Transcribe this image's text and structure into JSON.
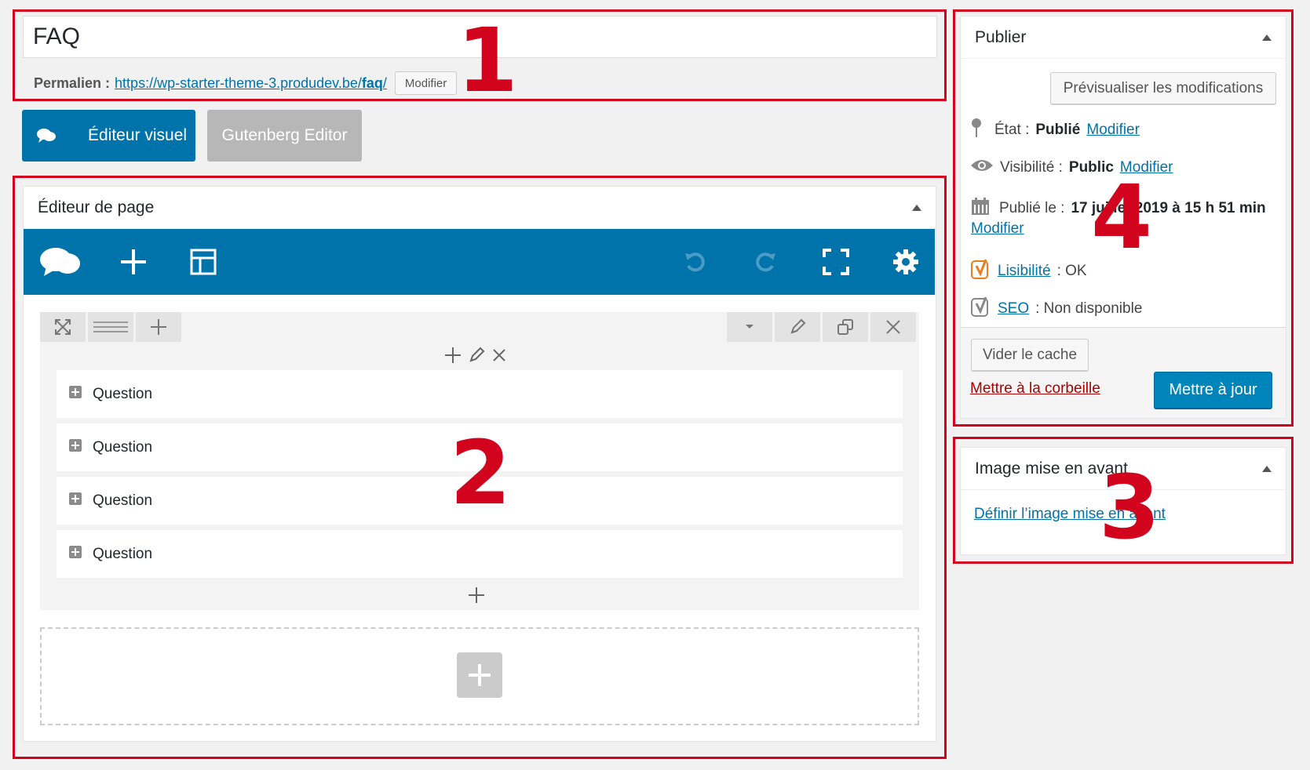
{
  "post_title": "FAQ",
  "permalink": {
    "label": "Permalien :",
    "url_base": "https://wp-starter-theme-3.produdev.be/",
    "slug": "faq",
    "url_tail": "/",
    "edit_button": "Modifier"
  },
  "editor_switch": {
    "visual_label": "Éditeur visuel",
    "gutenberg_label": "Gutenberg Editor"
  },
  "page_editor": {
    "title": "Éditeur de page",
    "questions": [
      "Question",
      "Question",
      "Question",
      "Question"
    ]
  },
  "publish": {
    "title": "Publier",
    "preview_button": "Prévisualiser les modifications",
    "status_label": "État :",
    "status_value": "Publié",
    "visibility_label": "Visibilité :",
    "visibility_value": "Public",
    "published_label": "Publié le :",
    "published_value": "17 juillet 2019 à 15 h 51 min",
    "modify_link": "Modifier",
    "readability_link": "Lisibilité",
    "readability_value": ": OK",
    "seo_link": "SEO",
    "seo_value": ": Non disponible",
    "clear_cache_button": "Vider le cache",
    "trash_link": "Mettre à la corbeille",
    "update_button": "Mettre à jour"
  },
  "featured_image": {
    "title": "Image mise en avant",
    "set_link": "Définir l’image mise en avant"
  },
  "annotations": [
    "1",
    "2",
    "3",
    "4"
  ],
  "colors": {
    "accent": "#0073aa",
    "annotation": "#d1031d",
    "yoast_readability": "#ee7c1b"
  }
}
